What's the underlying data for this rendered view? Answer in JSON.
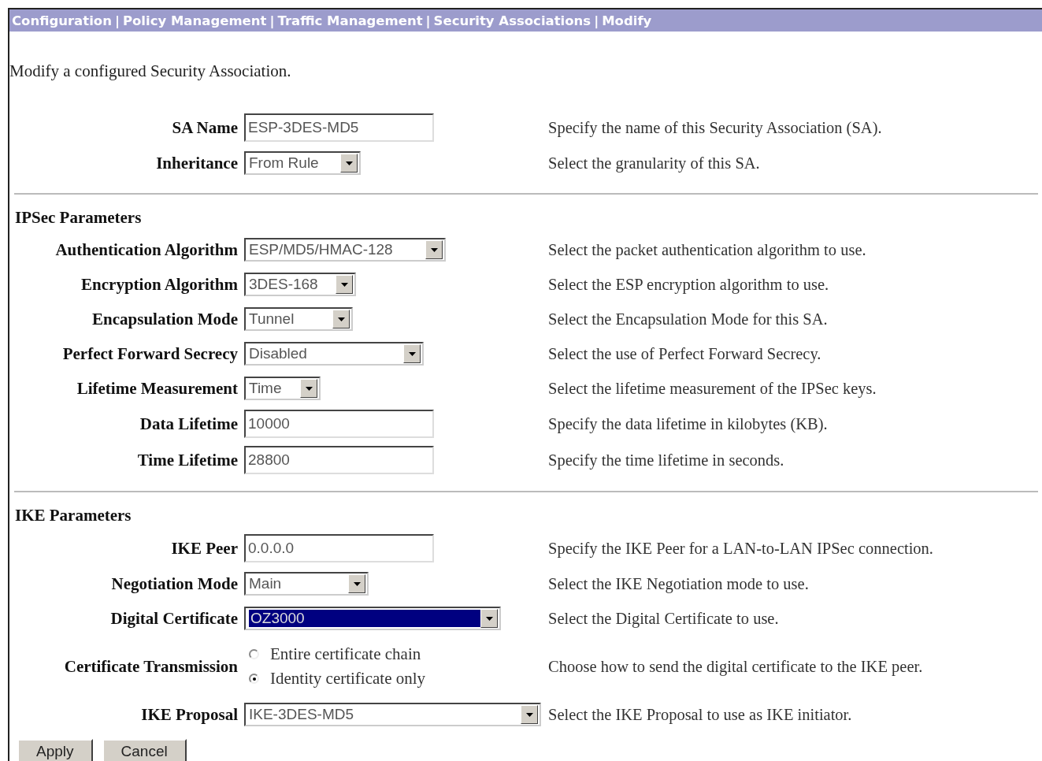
{
  "breadcrumb": [
    {
      "label": "Configuration"
    },
    {
      "label": "Policy Management"
    },
    {
      "label": "Traffic Management"
    },
    {
      "label": "Security Associations"
    },
    {
      "label": "Modify"
    }
  ],
  "separator": "|",
  "intro": "Modify a configured Security Association.",
  "sections": [
    {
      "rows": [
        {
          "kind": "text",
          "label": "SA Name",
          "value": "ESP-3DES-MD5",
          "help": "Specify the name of this Security Association (SA)."
        },
        {
          "kind": "select",
          "label": "Inheritance",
          "value": "From Rule",
          "help": "Select the granularity of this SA."
        }
      ]
    },
    {
      "title": "IPSec Parameters",
      "rows": [
        {
          "kind": "select",
          "label": "Authentication Algorithm",
          "value": "ESP/MD5/HMAC-128",
          "help": "Select the packet authentication algorithm to use."
        },
        {
          "kind": "select",
          "label": "Encryption Algorithm",
          "value": "3DES-168",
          "help": "Select the ESP encryption algorithm to use."
        },
        {
          "kind": "select",
          "label": "Encapsulation Mode",
          "value": "Tunnel",
          "help": "Select the Encapsulation Mode for this SA."
        },
        {
          "kind": "select",
          "label": "Perfect Forward Secrecy",
          "value": "Disabled",
          "help": "Select the use of Perfect Forward Secrecy."
        },
        {
          "kind": "select",
          "label": "Lifetime Measurement",
          "value": "Time",
          "help": "Select the lifetime measurement of the IPSec keys."
        },
        {
          "kind": "text",
          "label": "Data Lifetime",
          "value": "10000",
          "help": "Specify the data lifetime in kilobytes (KB)."
        },
        {
          "kind": "text",
          "label": "Time Lifetime",
          "value": "28800",
          "help": "Specify the time lifetime in seconds."
        }
      ]
    },
    {
      "title": "IKE Parameters",
      "rows": [
        {
          "kind": "text",
          "label": "IKE Peer",
          "value": "0.0.0.0",
          "help": "Specify the IKE Peer for a LAN-to-LAN IPSec connection."
        },
        {
          "kind": "select",
          "label": "Negotiation Mode",
          "value": "Main",
          "help": "Select the IKE Negotiation mode to use."
        },
        {
          "kind": "select",
          "label": "Digital Certificate",
          "value": "OZ3000",
          "focused": true,
          "help": "Select the Digital Certificate to use."
        },
        {
          "kind": "radio",
          "label": "Certificate Transmission",
          "options": [
            {
              "label": "Entire certificate chain",
              "selected": false
            },
            {
              "label": "Identity certificate only",
              "selected": true
            }
          ],
          "help": "Choose how to send the digital certificate to the IKE peer."
        },
        {
          "kind": "select",
          "label": "IKE Proposal",
          "value": "IKE-3DES-MD5",
          "help": "Select the IKE Proposal to use as IKE initiator."
        }
      ]
    }
  ],
  "buttons": [
    {
      "label": "Apply"
    },
    {
      "label": "Cancel"
    }
  ]
}
